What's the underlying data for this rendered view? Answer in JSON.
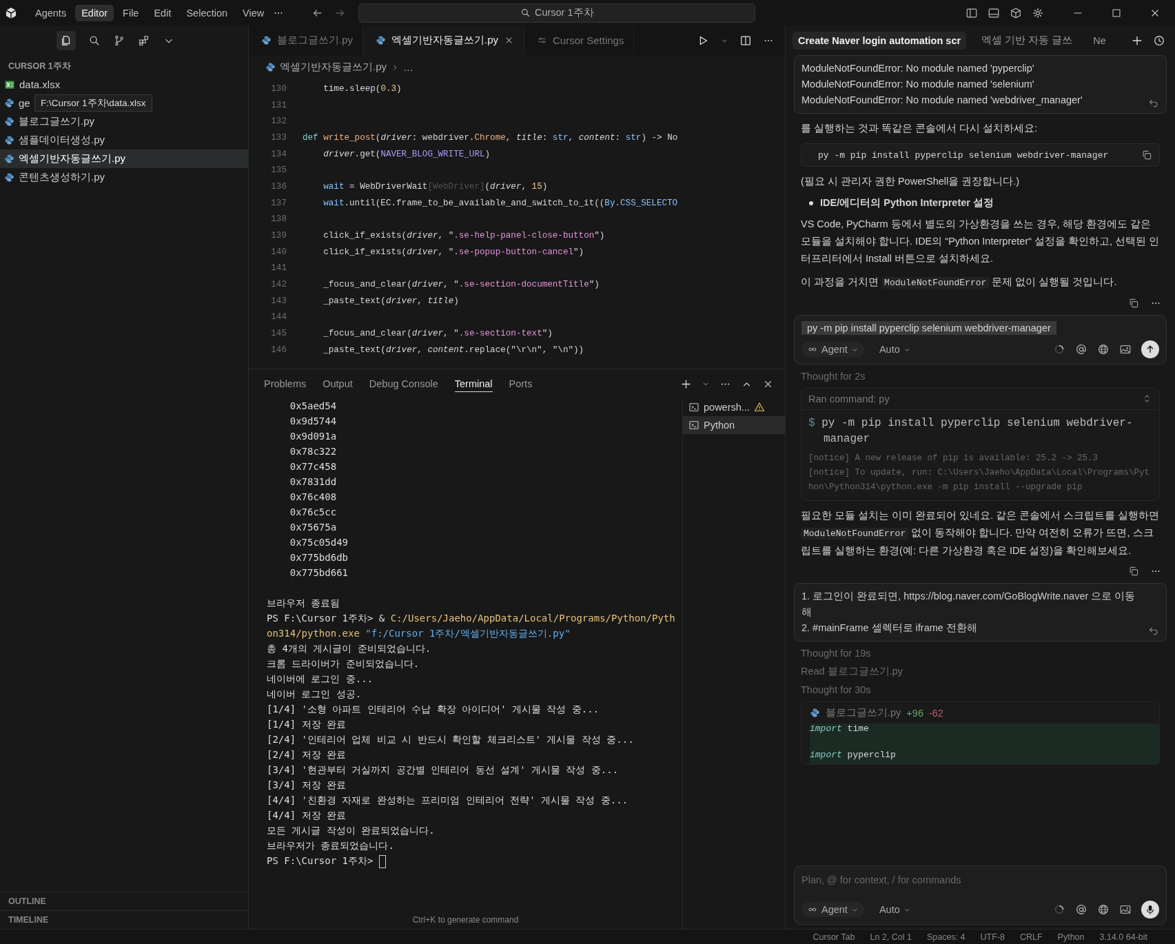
{
  "titlebar": {
    "modes": [
      {
        "label": "Agents",
        "selected": false
      },
      {
        "label": "Editor",
        "selected": true
      }
    ],
    "menu": [
      "File",
      "Edit",
      "Selection",
      "View"
    ],
    "search": "Cursor 1주차"
  },
  "sidebar": {
    "title": "CURSOR 1주차",
    "files": [
      {
        "name": "data.xlsx",
        "kind": "excel",
        "selected": false
      },
      {
        "name": "ge",
        "kind": "python",
        "selected": false
      },
      {
        "name": "블로그글쓰기.py",
        "kind": "python",
        "selected": false
      },
      {
        "name": "샘플데이터생성.py",
        "kind": "python",
        "selected": false
      },
      {
        "name": "엑셀기반자동글쓰기.py",
        "kind": "python",
        "selected": true
      },
      {
        "name": "콘텐츠생성하기.py",
        "kind": "python",
        "selected": false
      }
    ],
    "tooltip": "F:\\Cursor 1주차\\data.xlsx",
    "sections": [
      "OUTLINE",
      "TIMELINE"
    ]
  },
  "editor": {
    "tabs": [
      {
        "label": "블로그글쓰기.py",
        "kind": "python",
        "selected": false
      },
      {
        "label": "엑셀기반자동글쓰기.py",
        "kind": "python",
        "selected": true
      },
      {
        "label": "Cursor Settings",
        "kind": "settings",
        "selected": false
      }
    ],
    "breadcrumb": [
      "엑셀기반자동글쓰기.py",
      "…"
    ],
    "lines": [
      {
        "n": "130",
        "tokens": [
          {
            "kind": "plain",
            "text": "    time.sleep("
          },
          {
            "kind": "number",
            "text": "0.3"
          },
          {
            "kind": "plain",
            "text": ")"
          }
        ]
      },
      {
        "n": "131"
      },
      {
        "n": "132"
      },
      {
        "n": "133",
        "tokens": [
          {
            "kind": "keyword",
            "text": "def "
          },
          {
            "kind": "func",
            "text": "write_post"
          },
          {
            "kind": "plain",
            "text": "("
          },
          {
            "kind": "param",
            "text": "driver"
          },
          {
            "kind": "plain",
            "text": ": webdriver."
          },
          {
            "kind": "func",
            "text": "Chrome"
          },
          {
            "kind": "plain",
            "text": ", "
          },
          {
            "kind": "param",
            "text": "title"
          },
          {
            "kind": "plain",
            "text": ": "
          },
          {
            "kind": "type",
            "text": "str"
          },
          {
            "kind": "plain",
            "text": ", "
          },
          {
            "kind": "param",
            "text": "content"
          },
          {
            "kind": "plain",
            "text": ": "
          },
          {
            "kind": "type",
            "text": "str"
          },
          {
            "kind": "plain",
            "text": ") -> No"
          }
        ]
      },
      {
        "n": "134",
        "tokens": [
          {
            "kind": "param",
            "text": "    driver"
          },
          {
            "kind": "plain",
            "text": ".get("
          },
          {
            "kind": "const",
            "text": "NAVER_BLOG_WRITE_URL"
          },
          {
            "kind": "plain",
            "text": ")"
          }
        ]
      },
      {
        "n": "135"
      },
      {
        "n": "136",
        "tokens": [
          {
            "kind": "type",
            "text": "    wait"
          },
          {
            "kind": "plain",
            "text": " = WebDriverWait"
          },
          {
            "kind": "dim",
            "text": "[WebDriver]"
          },
          {
            "kind": "plain",
            "text": "("
          },
          {
            "kind": "param",
            "text": "driver"
          },
          {
            "kind": "plain",
            "text": ", "
          },
          {
            "kind": "number",
            "text": "15"
          },
          {
            "kind": "plain",
            "text": ")"
          }
        ]
      },
      {
        "n": "137",
        "tokens": [
          {
            "kind": "type",
            "text": "    wait"
          },
          {
            "kind": "plain",
            "text": ".until(EC.frame_to_be_available_and_switch_to_it(("
          },
          {
            "kind": "type",
            "text": "By.CSS_SELECTO"
          }
        ]
      },
      {
        "n": "138"
      },
      {
        "n": "139",
        "tokens": [
          {
            "kind": "plain",
            "text": "    click_if_exists("
          },
          {
            "kind": "param",
            "text": "driver"
          },
          {
            "kind": "plain",
            "text": ", \""
          },
          {
            "kind": "string",
            "text": ".se-help-panel-close-button"
          },
          {
            "kind": "plain",
            "text": "\")"
          }
        ]
      },
      {
        "n": "140",
        "tokens": [
          {
            "kind": "plain",
            "text": "    click_if_exists("
          },
          {
            "kind": "param",
            "text": "driver"
          },
          {
            "kind": "plain",
            "text": ", \""
          },
          {
            "kind": "string",
            "text": ".se-popup-button-cancel"
          },
          {
            "kind": "plain",
            "text": "\")"
          }
        ]
      },
      {
        "n": "141"
      },
      {
        "n": "142",
        "tokens": [
          {
            "kind": "plain",
            "text": "    _focus_and_clear("
          },
          {
            "kind": "param",
            "text": "driver"
          },
          {
            "kind": "plain",
            "text": ", \""
          },
          {
            "kind": "string",
            "text": ".se-section-documentTitle"
          },
          {
            "kind": "plain",
            "text": "\")"
          }
        ]
      },
      {
        "n": "143",
        "tokens": [
          {
            "kind": "plain",
            "text": "    _paste_text("
          },
          {
            "kind": "param",
            "text": "driver"
          },
          {
            "kind": "plain",
            "text": ", "
          },
          {
            "kind": "param",
            "text": "title"
          },
          {
            "kind": "plain",
            "text": ")"
          }
        ]
      },
      {
        "n": "144"
      },
      {
        "n": "145",
        "tokens": [
          {
            "kind": "plain",
            "text": "    _focus_and_clear("
          },
          {
            "kind": "param",
            "text": "driver"
          },
          {
            "kind": "plain",
            "text": ", \""
          },
          {
            "kind": "string",
            "text": ".se-section-text"
          },
          {
            "kind": "plain",
            "text": "\")"
          }
        ]
      },
      {
        "n": "146",
        "tokens": [
          {
            "kind": "plain",
            "text": "    _paste_text("
          },
          {
            "kind": "param",
            "text": "driver"
          },
          {
            "kind": "plain",
            "text": ", "
          },
          {
            "kind": "param",
            "text": "content"
          },
          {
            "kind": "plain",
            "text": ".replace(\"\\r\\n\", \"\\n\"))"
          }
        ]
      }
    ]
  },
  "panel": {
    "tabs": [
      {
        "label": "Problems",
        "selected": false
      },
      {
        "label": "Output",
        "selected": false
      },
      {
        "label": "Debug Console",
        "selected": false
      },
      {
        "label": "Terminal",
        "selected": true
      },
      {
        "label": "Ports",
        "selected": false
      }
    ],
    "terminal": [
      {
        "kind": "text",
        "text": "    0x5aed54"
      },
      {
        "kind": "text",
        "text": "    0x9d5744"
      },
      {
        "kind": "text",
        "text": "    0x9d091a"
      },
      {
        "kind": "text",
        "text": "    0x78c322"
      },
      {
        "kind": "text",
        "text": "    0x77c458"
      },
      {
        "kind": "text",
        "text": "    0x7831dd"
      },
      {
        "kind": "text",
        "text": "    0x76c408"
      },
      {
        "kind": "text",
        "text": "    0x76c5cc"
      },
      {
        "kind": "text",
        "text": "    0x75675a"
      },
      {
        "kind": "text",
        "text": "    0x75c05d49"
      },
      {
        "kind": "text",
        "text": "    0x775bd6db"
      },
      {
        "kind": "text",
        "text": "    0x775bd661"
      },
      {
        "kind": "blank"
      },
      {
        "kind": "text",
        "text": "브라우저 종료됨"
      },
      {
        "kind": "command",
        "prompt": "PS F:\\Cursor 1주차> ",
        "operator": "& ",
        "program": "C:/Users/Jaeho/AppData/Local/Programs/Python/Python314/python.exe",
        "argument": " \"f:/Cursor 1주차/엑셀기반자동글쓰기.py\""
      },
      {
        "kind": "text",
        "text": "총 4개의 게시글이 준비되었습니다."
      },
      {
        "kind": "text",
        "text": "크롬 드라이버가 준비되었습니다."
      },
      {
        "kind": "text",
        "text": "네이버에 로그인 중..."
      },
      {
        "kind": "text",
        "text": "네이버 로그인 성공."
      },
      {
        "kind": "text",
        "text": "[1/4] '소형 아파트 인테리어 수납 확장 아이디어' 게시물 작성 중..."
      },
      {
        "kind": "text",
        "text": "[1/4] 저장 완료"
      },
      {
        "kind": "text",
        "text": "[2/4] '인테리어 업체 비교 시 반드시 확인할 체크리스트' 게시물 작성 중..."
      },
      {
        "kind": "text",
        "text": "[2/4] 저장 완료"
      },
      {
        "kind": "text",
        "text": "[3/4] '현관부터 거실까지 공간별 인테리어 동선 설계' 게시물 작성 중..."
      },
      {
        "kind": "text",
        "text": "[3/4] 저장 완료"
      },
      {
        "kind": "text",
        "text": "[4/4] '친환경 자재로 완성하는 프리미엄 인테리어 전략' 게시물 작성 중..."
      },
      {
        "kind": "text",
        "text": "[4/4] 저장 완료"
      },
      {
        "kind": "text",
        "text": "모든 게시글 작성이 완료되었습니다."
      },
      {
        "kind": "text",
        "text": "브라우저가 종료되었습니다."
      },
      {
        "kind": "prompt",
        "text": "PS F:\\Cursor 1주차> "
      }
    ],
    "sessions": [
      {
        "label": "powersh...",
        "selected": false,
        "warning": true
      },
      {
        "label": "Python",
        "selected": true,
        "warning": false
      }
    ],
    "hint": "Ctrl+K to generate command"
  },
  "chat": {
    "tabs": [
      {
        "label": "Create Naver login automation scr",
        "selected": true
      },
      {
        "label": "엑셀 기반 자동 글쓰",
        "selected": false
      },
      {
        "label": "Ne",
        "selected": false
      }
    ],
    "pinned_message": [
      "ModuleNotFoundError: No module named 'pyperclip'",
      "ModuleNotFoundError: No module named 'selenium'",
      "ModuleNotFoundError: No module named 'webdriver_manager'"
    ],
    "blocks": [
      {
        "kind": "paragraph",
        "segments": [
          {
            "text": "를 실행하는 것과 똑같은 콘솔에서 다시 설치하세요:",
            "code": false
          }
        ]
      },
      {
        "kind": "code",
        "text": "py -m pip install pyperclip selenium webdriver-manager"
      },
      {
        "kind": "paragraph",
        "segments": [
          {
            "text": "(필요 시 관리자 권한 PowerShell을 권장합니다.)",
            "code": false
          }
        ]
      },
      {
        "kind": "bullet",
        "text": "IDE/에디터의 Python Interpreter 설정"
      },
      {
        "kind": "paragraph",
        "segments": [
          {
            "text": "VS Code, PyCharm 등에서 별도의 가상환경을 쓰는 경우, 해당 환경에도 같은 모듈을 설치해야 합니다. IDE의 “Python Interpreter“ 설정을 확인하고, 선택된 인터프리터에서 Install 버튼으로 설치하세요.",
            "code": false
          }
        ]
      },
      {
        "kind": "paragraph",
        "segments": [
          {
            "text": "이 과정을 거치면 ",
            "code": false
          },
          {
            "text": "ModuleNotFoundError",
            "code": true
          },
          {
            "text": " 문제 없이 실행될 것입니다.",
            "code": false
          }
        ]
      },
      {
        "kind": "actions"
      },
      {
        "kind": "edit_box",
        "value": "py -m pip install pyperclip selenium webdriver-manager",
        "text_selected": true,
        "mode": "Agent",
        "model": "Auto"
      },
      {
        "kind": "status",
        "text": "Thought for 2s"
      },
      {
        "kind": "command",
        "title": "Ran command: py",
        "prompt": "$",
        "command": "py -m pip install pyperclip selenium webdriver-manager",
        "output": [
          "[notice] A new release of pip is available: 25.2 -> 25.3",
          "[notice] To update, run: C:\\Users\\Jaeho\\AppData\\Local\\Programs\\Python\\Python314\\python.exe -m pip install --upgrade pip"
        ]
      },
      {
        "kind": "paragraph",
        "segments": [
          {
            "text": "필요한 모듈 설치는 이미 완료되어 있네요. 같은 콘솔에서 스크립트를 실행하면 ",
            "code": false
          },
          {
            "text": "ModuleNotFoundError",
            "code": true
          },
          {
            "text": " 없이 동작해야 합니다. 만약 여전히 오류가 뜨면, 스크립트를 실행하는 환경(예: 다른 가상환경 혹은 IDE 설정)을 확인해보세요.",
            "code": false
          }
        ]
      },
      {
        "kind": "actions"
      },
      {
        "kind": "user_message",
        "lines": [
          "1. 로그인이 완료되면, https://blog.naver.com/GoBlogWrite.naver 으로 이동해",
          "2. #mainFrame 셀렉터로 iframe 전환해"
        ]
      },
      {
        "kind": "status",
        "text": "Thought for 19s"
      },
      {
        "kind": "status",
        "text": "Read 블로그글쓰기.py"
      },
      {
        "kind": "status",
        "text": "Thought for 30s"
      },
      {
        "kind": "diff",
        "file": "블로그글쓰기.py",
        "added": "+96",
        "removed": "-62",
        "lines": [
          {
            "tokens": [
              {
                "kind": "keyword",
                "text": "import"
              },
              {
                "kind": "plain",
                "text": " time"
              }
            ]
          },
          {
            "tokens": [
              {
                "kind": "keyword",
                "text": "import"
              },
              {
                "kind": "plain",
                "text": " pyperclip"
              }
            ]
          }
        ]
      }
    ],
    "composer": {
      "placeholder": "Plan, @ for context, / for commands",
      "mode": "Agent",
      "model": "Auto"
    }
  },
  "statusbar": {
    "items": [
      "Cursor Tab",
      "Ln 2, Col 1",
      "Spaces: 4",
      "UTF-8",
      "CRLF",
      "Python",
      "3.14.0 64-bit"
    ]
  }
}
